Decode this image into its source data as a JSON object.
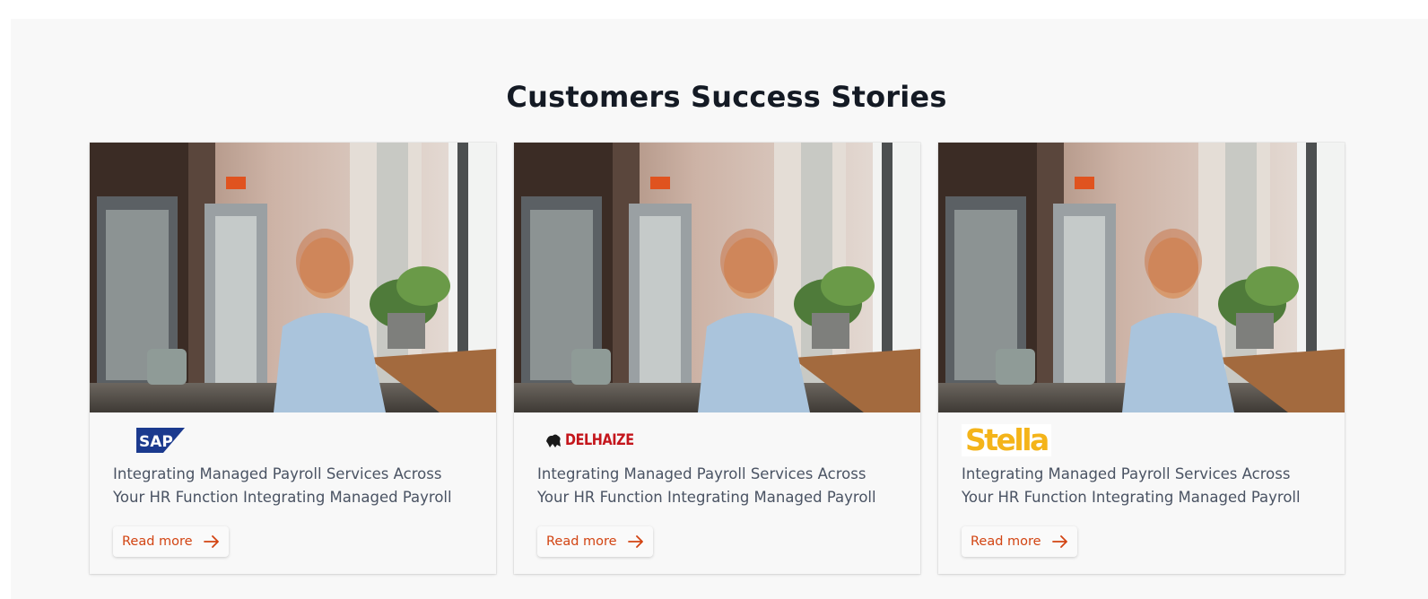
{
  "section": {
    "title": "Customers Success Stories"
  },
  "cards": [
    {
      "logo_text": "SAP",
      "logo_icon": "sap-logo-icon",
      "description": "Integrating Managed Payroll Services Across Your HR Function Integrating Managed Payroll Services Ac",
      "button_label": "Read more",
      "button_icon": "arrow-right-icon"
    },
    {
      "logo_text": "DELHAIZE",
      "logo_icon": "delhaize-lion-icon",
      "description": "Integrating Managed Payroll Services Across Your HR Function Integrating Managed Payroll Services Ac",
      "button_label": "Read more",
      "button_icon": "arrow-right-icon"
    },
    {
      "logo_text": "Stella",
      "logo_icon": "stella-logo-icon",
      "description": "Integrating Managed Payroll Services Across Your HR Function Integrating Managed Payroll Services Ac",
      "button_label": "Read more",
      "button_icon": "arrow-right-icon"
    }
  ],
  "colors": {
    "accent": "#d24412",
    "title": "#141a24",
    "body_text": "#4a5363",
    "section_bg": "#f8f8f8",
    "sap_blue": "#1b3a8e",
    "delhaize_red": "#c4161c",
    "stella_yellow": "#f4b41a"
  }
}
